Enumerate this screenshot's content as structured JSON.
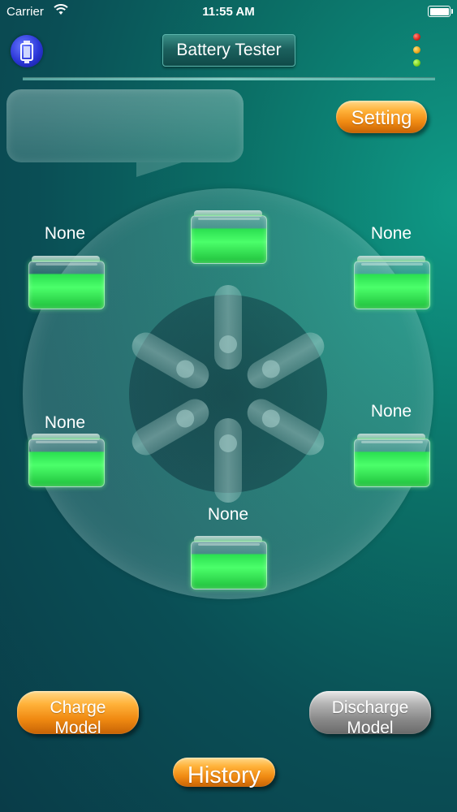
{
  "status_bar": {
    "carrier": "Carrier",
    "time": "11:55 AM",
    "wifi_icon": "wifi-icon",
    "battery_icon": "battery-full-icon"
  },
  "header": {
    "logo_icon": "battery-cell-logo-icon",
    "title": "Battery Tester",
    "indicator_lights": [
      "red",
      "yellow",
      "green"
    ]
  },
  "message": {
    "text": ""
  },
  "buttons": {
    "setting": "Setting",
    "charge_line1": "Charge",
    "charge_line2": "Model",
    "discharge_line1": "Discharge",
    "discharge_line2": "Model",
    "history": "History"
  },
  "slots": [
    {
      "label": ""
    },
    {
      "label": "None"
    },
    {
      "label": "None"
    },
    {
      "label": "None"
    },
    {
      "label": "None"
    },
    {
      "label": "None"
    }
  ],
  "colors": {
    "accent_gold": "#f08a12",
    "disabled_grey": "#8a8a8a",
    "cell_green": "#2be051",
    "background": "#0b6f66"
  }
}
